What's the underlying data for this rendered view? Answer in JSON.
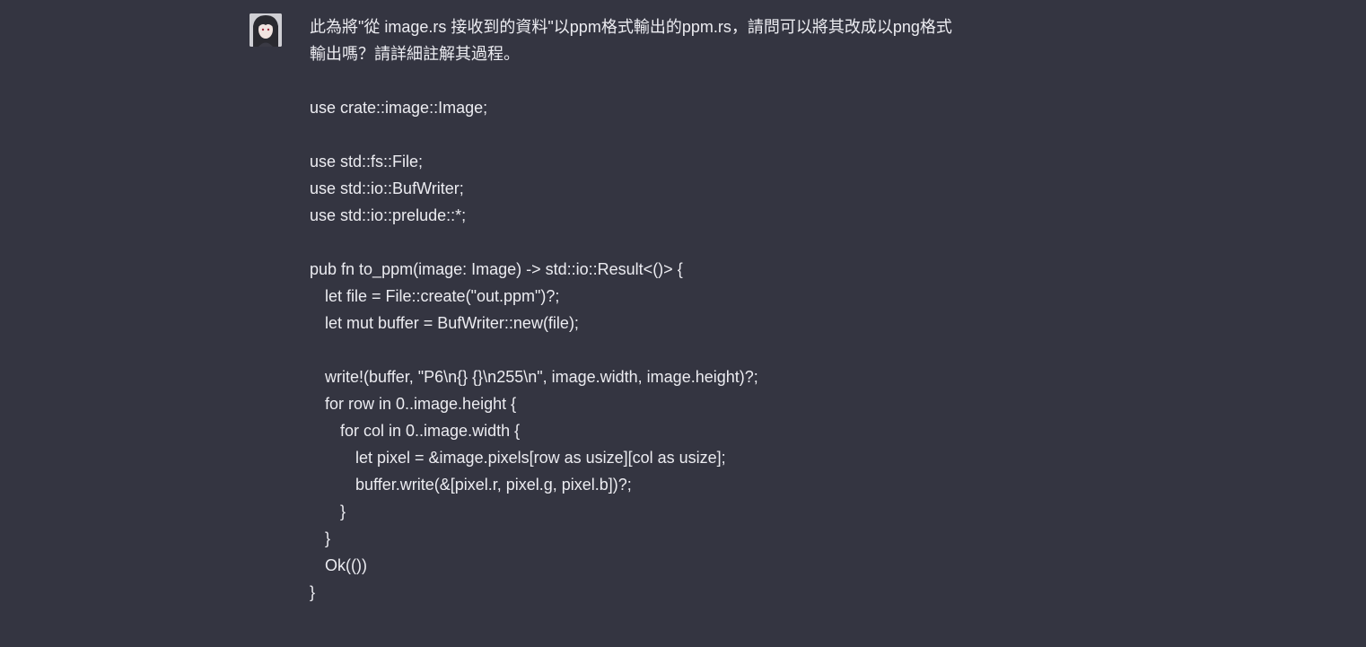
{
  "message": {
    "prompt_lines": [
      "此為將\"從 image.rs 接收到的資料\"以ppm格式輸出的ppm.rs，請問可以將其改成以png格式",
      "輸出嗎？請詳細註解其過程。"
    ],
    "code_lines": [
      "use crate::image::Image;",
      "",
      "use std::fs::File;",
      "use std::io::BufWriter;",
      "use std::io::prelude::*;",
      "",
      "pub fn to_ppm(image: Image) -> std::io::Result<()> {",
      "let file = File::create(\"out.ppm\")?;",
      "let mut buffer = BufWriter::new(file);",
      "",
      "write!(buffer, \"P6\\n{} {}\\n255\\n\", image.width, image.height)?;",
      "for row in 0..image.height {",
      "for col in 0..image.width {",
      "let pixel = &image.pixels[row as usize][col as usize];",
      "buffer.write(&[pixel.r, pixel.g, pixel.b])?;",
      "}",
      "}",
      "Ok(())",
      "}"
    ]
  }
}
